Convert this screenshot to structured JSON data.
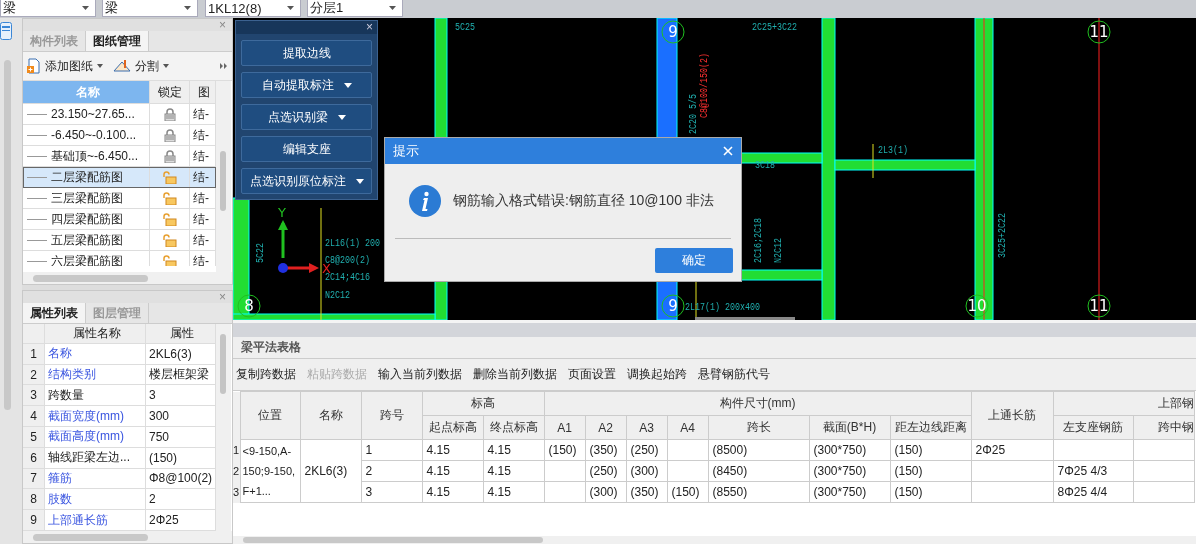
{
  "selects": [
    {
      "value": "梁"
    },
    {
      "value": "梁"
    },
    {
      "value": "1KL12(8)"
    },
    {
      "value": "分层1"
    }
  ],
  "drawing_panel": {
    "close": "×",
    "tabs": [
      {
        "label": "构件列表",
        "selected": false
      },
      {
        "label": "图纸管理",
        "selected": true
      }
    ],
    "tools": [
      {
        "label": "添加图纸"
      },
      {
        "label": "分割"
      }
    ],
    "columns": [
      "名称",
      "锁定",
      "图"
    ],
    "rows": [
      {
        "name": "23.150~27.65...",
        "locked": true,
        "code": "结-",
        "selected": false
      },
      {
        "name": "-6.450~-0.100...",
        "locked": true,
        "code": "结-",
        "selected": false
      },
      {
        "name": "基础顶~-6.450...",
        "locked": true,
        "code": "结-",
        "selected": false
      },
      {
        "name": "二层梁配筋图",
        "locked": false,
        "code": "结-",
        "selected": true
      },
      {
        "name": "三层梁配筋图",
        "locked": false,
        "code": "结-",
        "selected": false
      },
      {
        "name": "四层梁配筋图",
        "locked": false,
        "code": "结-",
        "selected": false
      },
      {
        "name": "五层梁配筋图",
        "locked": false,
        "code": "结-",
        "selected": false
      },
      {
        "name": "六层梁配筋图",
        "locked": false,
        "code": "结-",
        "selected": false
      }
    ]
  },
  "property_panel": {
    "close": "×",
    "tabs": [
      {
        "label": "属性列表",
        "selected": true
      },
      {
        "label": "图层管理",
        "selected": false
      }
    ],
    "columns": [
      "属性名称",
      "属性"
    ],
    "rows": [
      {
        "number": "1",
        "name": "名称",
        "value": "2KL6(3)",
        "public": true
      },
      {
        "number": "2",
        "name": "结构类别",
        "value": "楼层框架梁",
        "public": true
      },
      {
        "number": "3",
        "name": "跨数量",
        "value": "3",
        "public": false
      },
      {
        "number": "4",
        "name": "截面宽度(mm)",
        "value": "300",
        "public": true
      },
      {
        "number": "5",
        "name": "截面高度(mm)",
        "value": "750",
        "public": true
      },
      {
        "number": "6",
        "name": "轴线距梁左边...",
        "value": "(150)",
        "public": false
      },
      {
        "number": "7",
        "name": "箍筋",
        "value": "Φ8@100(2)",
        "public": true
      },
      {
        "number": "8",
        "name": "肢数",
        "value": "2",
        "public": true
      },
      {
        "number": "9",
        "name": "上部通长筋",
        "value": "2Φ25",
        "public": true
      }
    ]
  },
  "tool_panel": {
    "close": "×",
    "buttons": [
      {
        "label": "提取边线",
        "dropdown": false
      },
      {
        "label": "自动提取标注",
        "dropdown": true
      },
      {
        "label": "点选识别梁",
        "dropdown": true
      },
      {
        "label": "编辑支座",
        "dropdown": false
      },
      {
        "label": "点选识别原位标注",
        "dropdown": true
      }
    ]
  },
  "cad": {
    "axis_bubbles": [
      "9",
      "11",
      "8",
      "9",
      "10",
      "11"
    ],
    "labels": [
      "5C25",
      "2C25+3C22",
      "2L3(1)",
      "3C25+2C22",
      "5C22",
      "2L16(1) 200",
      "C8@200(2)",
      "2C14;4C16",
      "N2C12",
      "2C20 5/5",
      "3C18",
      "2C16;2C18",
      "N2C12",
      "2L17(1) 200x400",
      "C8@100/150(2)"
    ],
    "axes": {
      "y": "Y",
      "x": "X"
    }
  },
  "dialog": {
    "title": "提示",
    "message": "钢筋输入格式错误:钢筋直径 10@100 非法",
    "ok": "确定"
  },
  "beam_table": {
    "title": "梁平法表格",
    "actions": [
      {
        "label": "复制跨数据",
        "disabled": false
      },
      {
        "label": "粘贴跨数据",
        "disabled": true
      },
      {
        "label": "输入当前列数据",
        "disabled": false
      },
      {
        "label": "删除当前列数据",
        "disabled": false
      },
      {
        "label": "页面设置",
        "disabled": false
      },
      {
        "label": "调换起始跨",
        "disabled": false
      },
      {
        "label": "悬臂钢筋代号",
        "disabled": false
      }
    ],
    "headers": {
      "position": "位置",
      "name": "名称",
      "span": "跨号",
      "elevation": "标高",
      "start": "起点标高",
      "end": "终点标高",
      "size": "构件尺寸(mm)",
      "a1": "A1",
      "a2": "A2",
      "a3": "A3",
      "a4": "A4",
      "length": "跨长",
      "section": "截面(B*H)",
      "offset": "距左边线距离",
      "top_through": "上通长筋",
      "top_rebar": "上部钢",
      "left_support": "左支座钢筋",
      "mid": "跨中钢"
    },
    "position": "<9-150,A-150;9-150,F+1...",
    "name": "2KL6(3)",
    "rows": [
      {
        "number": "1",
        "span": "1",
        "start": "4.15",
        "end": "4.15",
        "a1": "(150)",
        "a2": "(350)",
        "a3": "(250)",
        "length": "(8500)",
        "section": "(300*750)",
        "offset": "(150)",
        "top_through": "2Φ25"
      },
      {
        "number": "2",
        "span": "2",
        "start": "4.15",
        "end": "4.15",
        "a2": "(250)",
        "a3": "(300)",
        "length": "(8450)",
        "section": "(300*750)",
        "offset": "(150)",
        "left_support": "7Φ25 4/3"
      },
      {
        "number": "3",
        "span": "3",
        "start": "4.15",
        "end": "4.15",
        "a2": "(300)",
        "a3": "(350)",
        "a4": "(150)",
        "length": "(8550)",
        "section": "(300*750)",
        "offset": "(150)",
        "left_support": "8Φ25 4/4"
      }
    ]
  }
}
